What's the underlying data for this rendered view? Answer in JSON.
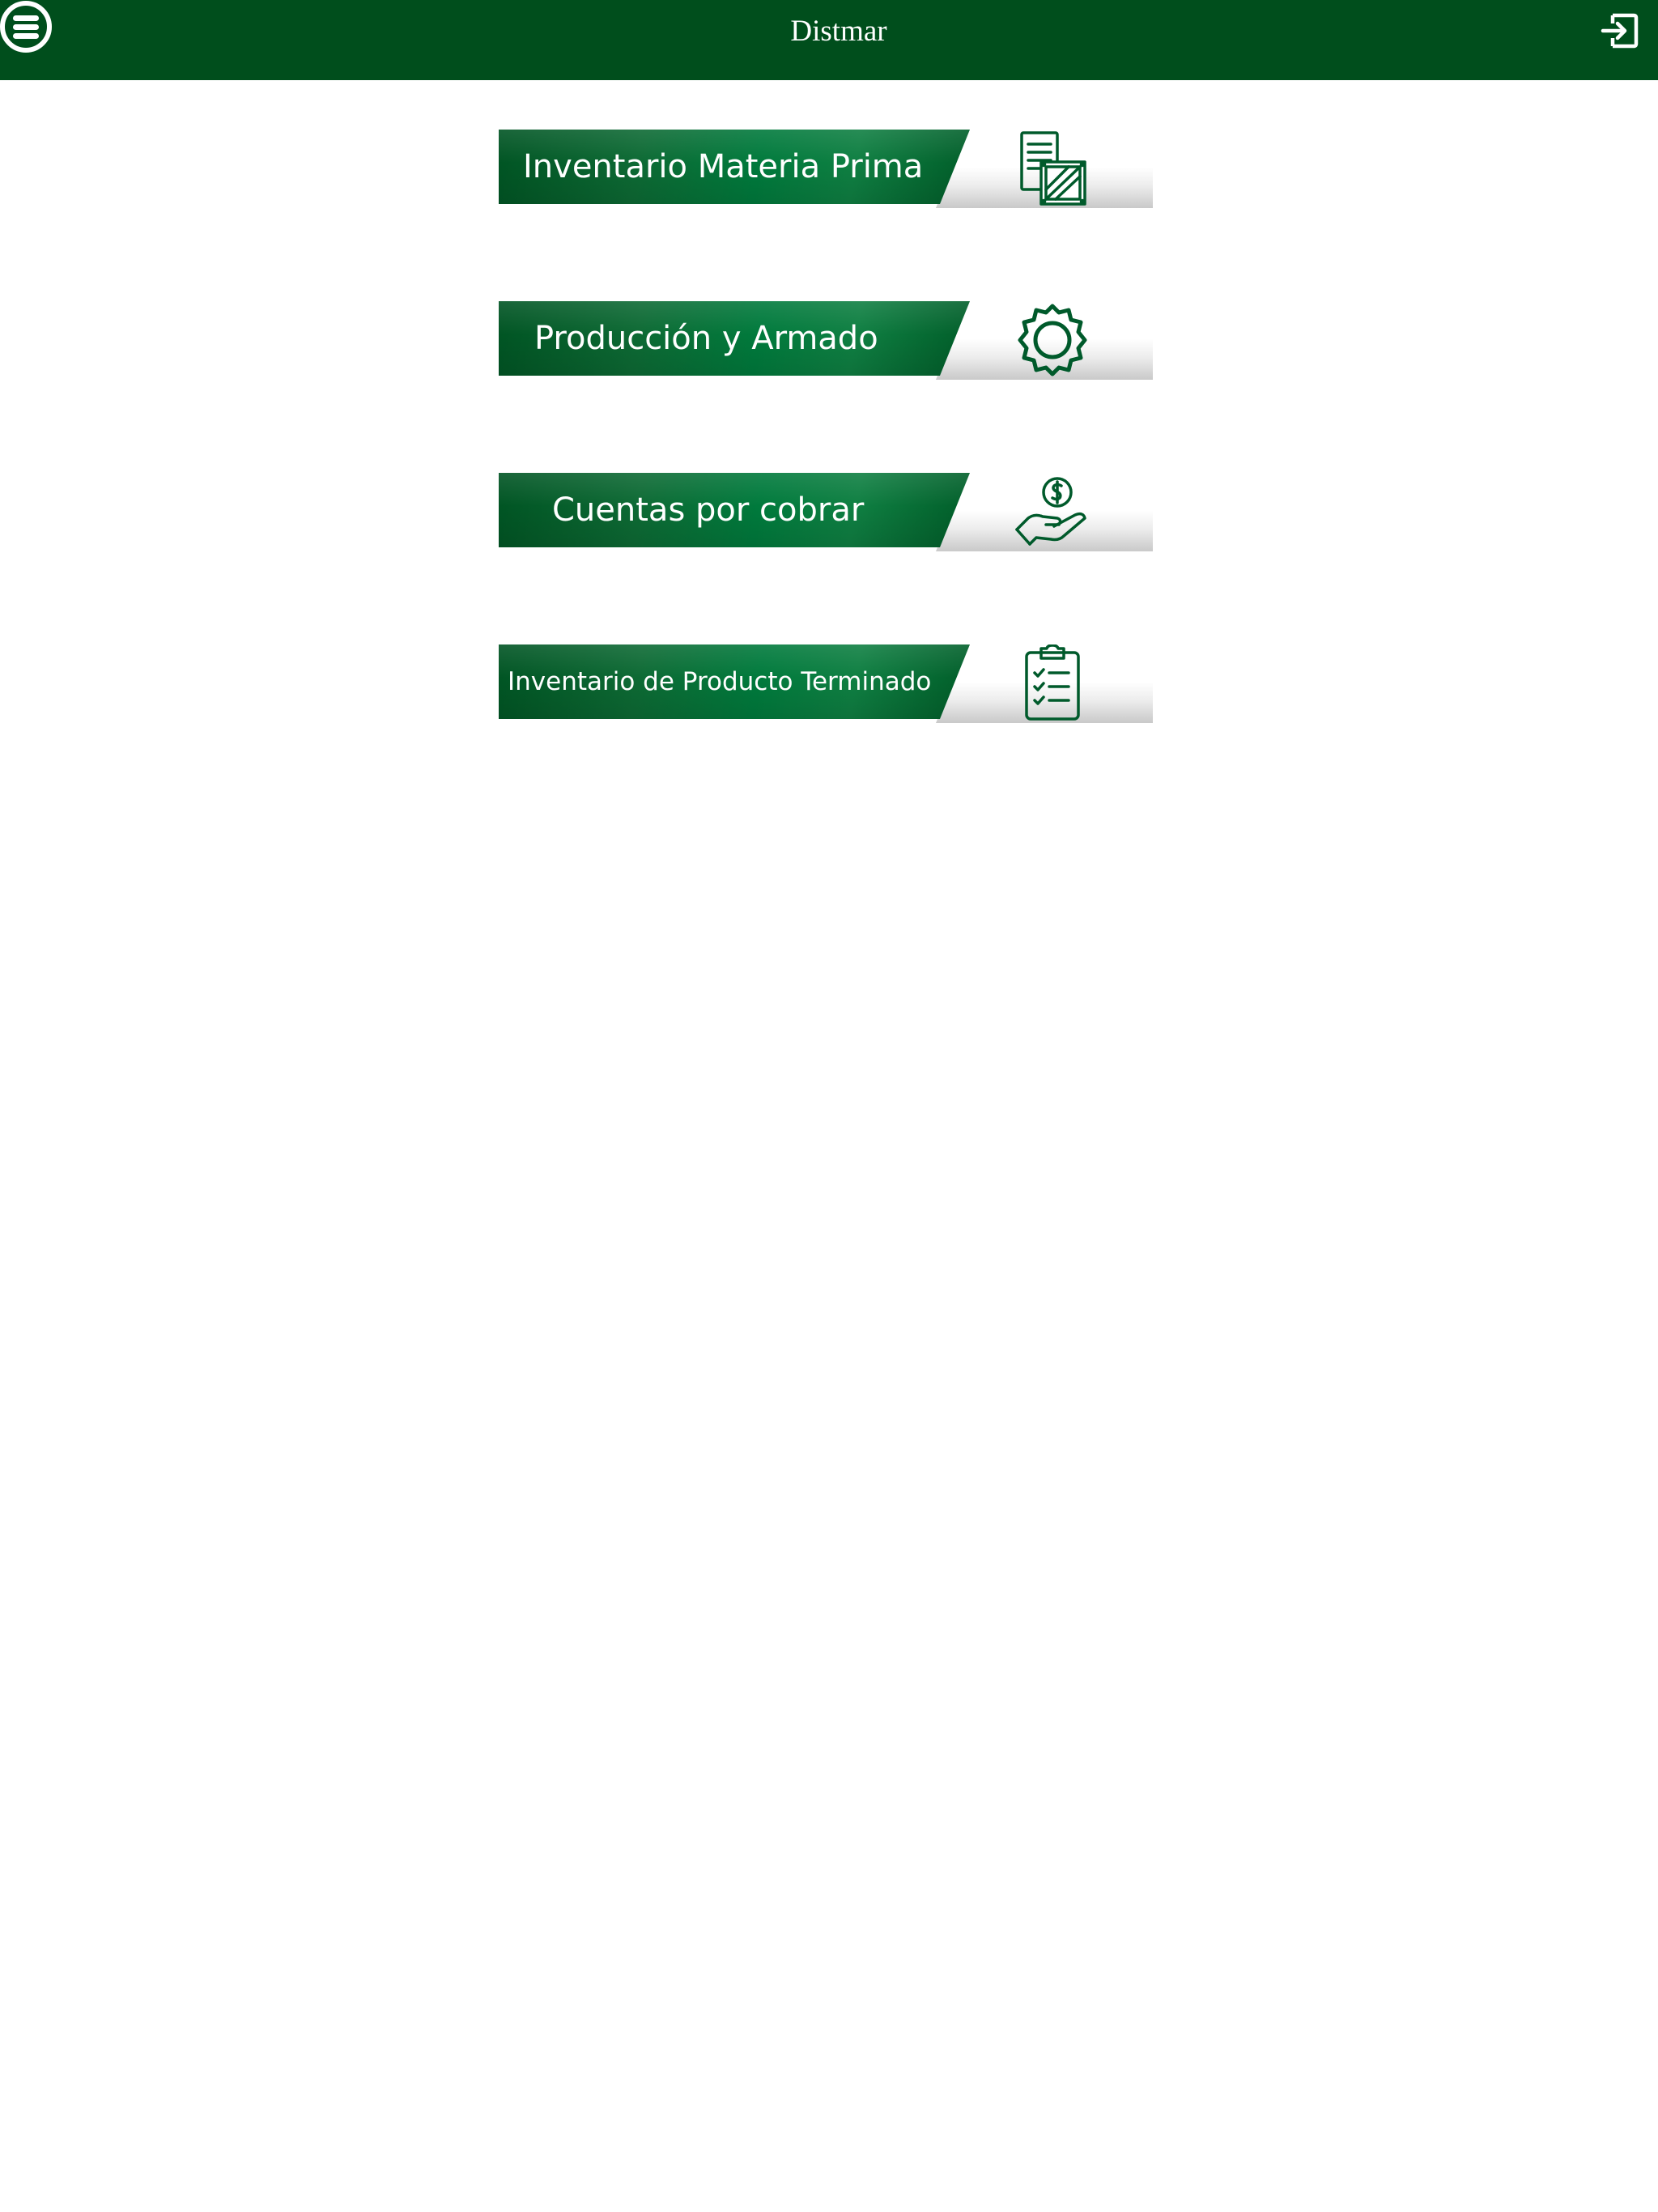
{
  "header": {
    "title": "Distmar",
    "menu_icon": "menu-icon",
    "logout_icon": "logout-icon",
    "background_color": "#004e1c"
  },
  "menu": {
    "items": [
      {
        "label": "Inventario Materia Prima",
        "icon": "raw-materials-inventory-icon"
      },
      {
        "label": "Producción y Armado",
        "icon": "gear-icon"
      },
      {
        "label": "Cuentas por cobrar",
        "icon": "money-hand-icon"
      },
      {
        "label": "Inventario de Producto Terminado",
        "icon": "clipboard-checklist-icon"
      }
    ]
  },
  "colors": {
    "brand_green": "#004e1c",
    "icon_green": "#005a2b"
  }
}
